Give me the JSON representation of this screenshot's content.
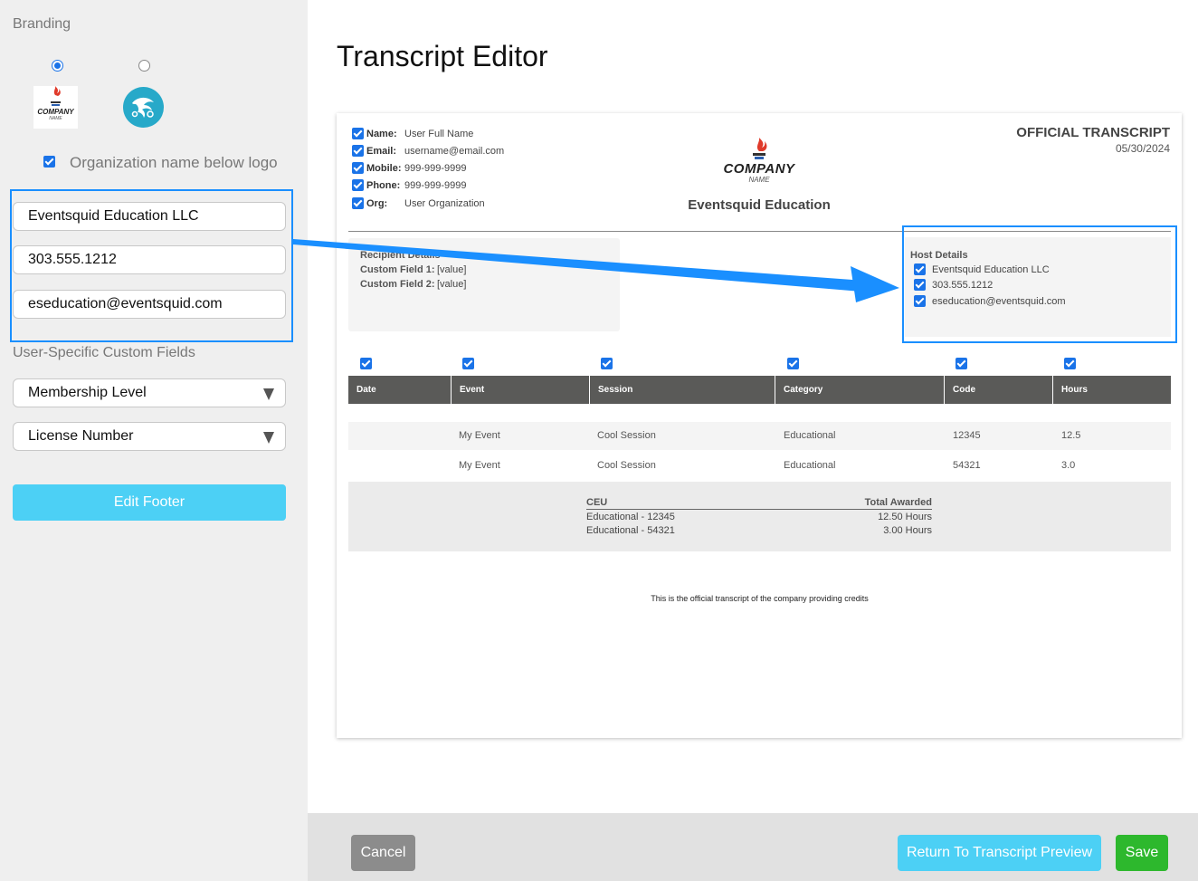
{
  "sidebar": {
    "branding_label": "Branding",
    "logo_text": "COMPANY",
    "logo_sub": "NAME",
    "org_below_logo_label": "Organization name below logo",
    "org_name_value": "Eventsquid Education LLC",
    "phone_value": "303.555.1212",
    "email_value": "eseducation@eventsquid.com",
    "custom_fields_label": "User-Specific Custom Fields",
    "custom_field_1": "Membership Level",
    "custom_field_2": "License Number",
    "edit_footer_label": "Edit Footer"
  },
  "page": {
    "title": "Transcript Editor"
  },
  "doc": {
    "user": [
      {
        "label": "Name:",
        "value": "User Full Name"
      },
      {
        "label": "Email:",
        "value": "username@email.com"
      },
      {
        "label": "Mobile:",
        "value": "999-999-9999"
      },
      {
        "label": "Phone:",
        "value": "999-999-9999"
      },
      {
        "label": "Org:",
        "value": "User Organization"
      }
    ],
    "logo_text": "COMPANY",
    "logo_sub": "NAME",
    "org_name": "Eventsquid Education",
    "official_title": "OFFICIAL TRANSCRIPT",
    "date": "05/30/2024",
    "recipient_title": "Recipient Details",
    "custom_field_1_label": "Custom Field 1:",
    "custom_field_1_value": "[value]",
    "custom_field_2_label": "Custom Field 2:",
    "custom_field_2_value": "[value]",
    "host_title": "Host Details",
    "host_org": "Eventsquid Education LLC",
    "host_phone": "303.555.1212",
    "host_email": "eseducation@eventsquid.com",
    "columns": [
      "Date",
      "Event",
      "Session",
      "Category",
      "Code",
      "Hours"
    ],
    "rows": [
      [
        "",
        "My Event",
        "Cool Session",
        "Educational",
        "12345",
        "12.5"
      ],
      [
        "",
        "My Event",
        "Cool Session",
        "Educational",
        "54321",
        "3.0"
      ]
    ],
    "ceu_header": "CEU",
    "total_header": "Total Awarded",
    "ceu_rows": [
      {
        "name": "Educational - 12345",
        "total": "12.50 Hours"
      },
      {
        "name": "Educational - 54321",
        "total": "3.00 Hours"
      }
    ],
    "footer_text": "This is the official transcript of the company providing credits"
  },
  "footer": {
    "cancel": "Cancel",
    "return": "Return To Transcript Preview",
    "save": "Save"
  },
  "colors": {
    "accent": "#1a73e8",
    "highlight": "#1a8fff",
    "edit_footer": "#4cd0f5",
    "save": "#2db82d",
    "cancel": "#8c8c8c"
  }
}
